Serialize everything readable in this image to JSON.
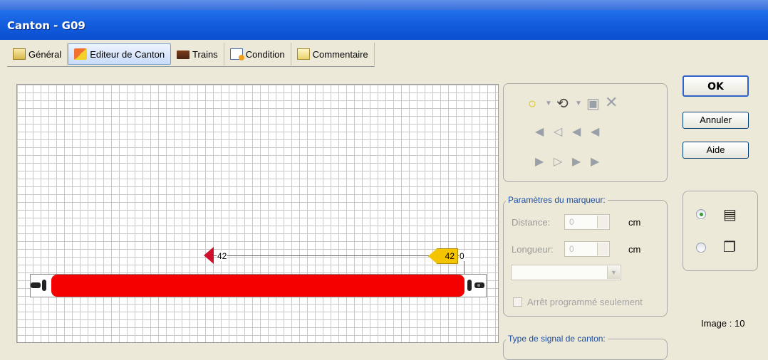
{
  "window": {
    "title": "Canton - G09"
  },
  "tabs": [
    {
      "label": "Général",
      "icon": "properties-icon",
      "active": false
    },
    {
      "label": "Editeur de Canton",
      "icon": "block-editor-icon",
      "active": true
    },
    {
      "label": "Trains",
      "icon": "trains-icon",
      "active": false
    },
    {
      "label": "Condition",
      "icon": "condition-icon",
      "active": false
    },
    {
      "label": "Commentaire",
      "icon": "comment-icon",
      "active": false
    }
  ],
  "editor": {
    "track_color": "#f40000",
    "start_marker_label": "42",
    "end_marker_label": "42",
    "end_offset_label": "0"
  },
  "toolbox": {
    "tools": [
      "circle-tool-icon",
      "dropdown-arrow-icon",
      "rotate-tool-icon",
      "dropdown-arrow-icon",
      "properties-tool-icon",
      "delete-tool-icon"
    ],
    "left_markers": [
      "marker-left-solid-icon",
      "marker-left-outline-icon",
      "marker-left-icon",
      "marker-left-thin-icon"
    ],
    "right_markers": [
      "marker-right-solid-icon",
      "marker-right-outline-icon",
      "marker-right-icon",
      "marker-right-thin-icon"
    ]
  },
  "marker_params": {
    "legend": "Paramètres du marqueur:",
    "distance_label": "Distance:",
    "distance_value": "0",
    "distance_unit": "cm",
    "length_label": "Longueur:",
    "length_value": "0",
    "length_unit": "cm",
    "scheduled_stop_label": "Arrêt programmé seulement"
  },
  "signal_type": {
    "legend": "Type de signal de canton:"
  },
  "buttons": {
    "ok": "OK",
    "cancel": "Annuler",
    "help": "Aide"
  },
  "view": {
    "selected": "list"
  },
  "image_label": "Image : 10"
}
